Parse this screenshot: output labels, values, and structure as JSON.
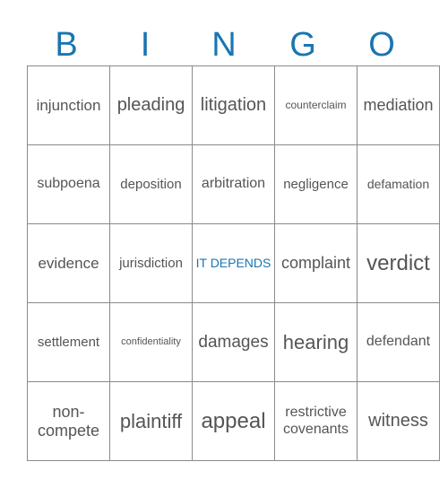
{
  "accent_color": "#1a75b0",
  "header": [
    "B",
    "I",
    "N",
    "G",
    "O"
  ],
  "rows": [
    [
      {
        "text": "injunction",
        "size": 17
      },
      {
        "text": "pleading",
        "size": 20
      },
      {
        "text": "litigation",
        "size": 20
      },
      {
        "text": "counterclaim",
        "size": 12
      },
      {
        "text": "mediation",
        "size": 18
      }
    ],
    [
      {
        "text": "subpoena",
        "size": 16
      },
      {
        "text": "deposition",
        "size": 15
      },
      {
        "text": "arbitration",
        "size": 16
      },
      {
        "text": "negligence",
        "size": 15
      },
      {
        "text": "defamation",
        "size": 14
      }
    ],
    [
      {
        "text": "evidence",
        "size": 17
      },
      {
        "text": "jurisdiction",
        "size": 15
      },
      {
        "text": "IT DEPENDS",
        "size": 14,
        "free": true
      },
      {
        "text": "complaint",
        "size": 18
      },
      {
        "text": "verdict",
        "size": 24
      }
    ],
    [
      {
        "text": "settlement",
        "size": 15
      },
      {
        "text": "confidentiality",
        "size": 11
      },
      {
        "text": "damages",
        "size": 19
      },
      {
        "text": "hearing",
        "size": 22
      },
      {
        "text": "defendant",
        "size": 16
      }
    ],
    [
      {
        "text": "non-compete",
        "size": 18
      },
      {
        "text": "plaintiff",
        "size": 22
      },
      {
        "text": "appeal",
        "size": 24
      },
      {
        "text": "restrictive covenants",
        "size": 16
      },
      {
        "text": "witness",
        "size": 20
      }
    ]
  ]
}
